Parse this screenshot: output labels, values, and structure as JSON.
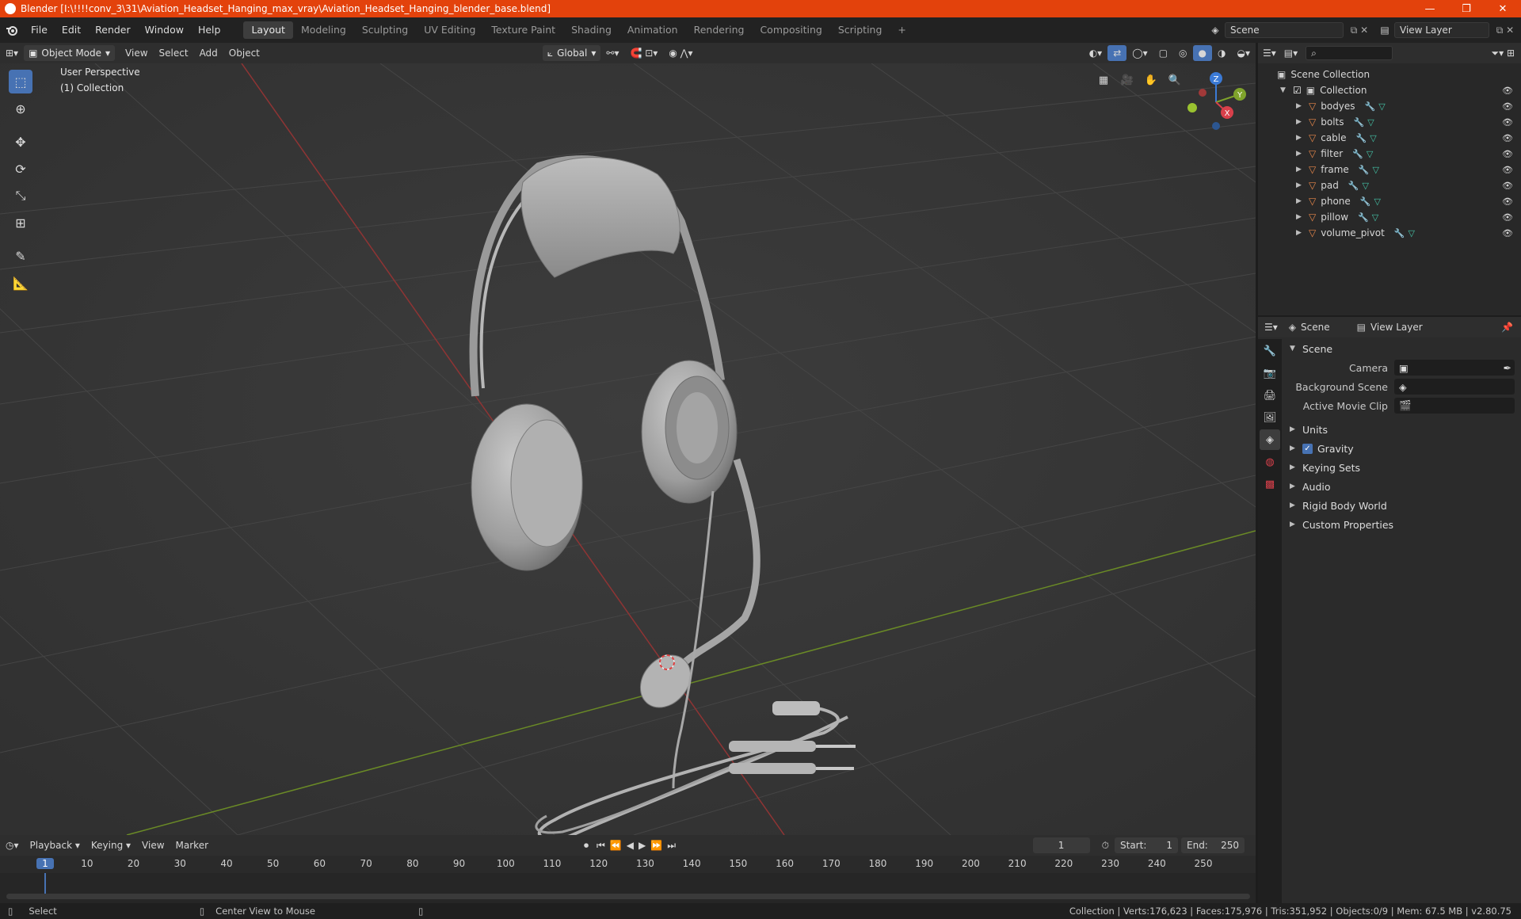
{
  "window": {
    "title": "Blender [I:\\!!!!conv_3\\31\\Aviation_Headset_Hanging_max_vray\\Aviation_Headset_Hanging_blender_base.blend]",
    "controls": [
      "—",
      "❐",
      "✕"
    ]
  },
  "menu": [
    "File",
    "Edit",
    "Render",
    "Window",
    "Help"
  ],
  "workspaces": [
    {
      "label": "Layout",
      "active": true
    },
    {
      "label": "Modeling"
    },
    {
      "label": "Sculpting"
    },
    {
      "label": "UV Editing"
    },
    {
      "label": "Texture Paint"
    },
    {
      "label": "Shading"
    },
    {
      "label": "Animation"
    },
    {
      "label": "Rendering"
    },
    {
      "label": "Compositing"
    },
    {
      "label": "Scripting"
    }
  ],
  "scene_field": "Scene",
  "view_layer_field": "View Layer",
  "viewport_header": {
    "mode": "Object Mode",
    "menus": [
      "View",
      "Select",
      "Add",
      "Object"
    ],
    "transform": "Global"
  },
  "viewport": {
    "perspective": "User Perspective",
    "collection": "(1) Collection"
  },
  "gizmo": {
    "z": "Z",
    "y": "Y",
    "x": "X"
  },
  "outliner": {
    "root": "Scene Collection",
    "collection": "Collection",
    "objects": [
      "bodyes",
      "bolts",
      "cable",
      "filter",
      "frame",
      "pad",
      "phone",
      "pillow",
      "volume_pivot"
    ]
  },
  "properties": {
    "tab_scene": "Scene",
    "tab_view_layer": "View Layer",
    "panel": "Scene",
    "fields": [
      {
        "label": "Camera"
      },
      {
        "label": "Background Scene"
      },
      {
        "label": "Active Movie Clip"
      }
    ],
    "sections": [
      {
        "label": "Units"
      },
      {
        "label": "Gravity",
        "checkbox": true
      },
      {
        "label": "Keying Sets"
      },
      {
        "label": "Audio"
      },
      {
        "label": "Rigid Body World"
      },
      {
        "label": "Custom Properties"
      }
    ]
  },
  "timeline": {
    "menus": [
      "Playback",
      "Keying",
      "View",
      "Marker"
    ],
    "current_frame": "1",
    "start_label": "Start:",
    "start": "1",
    "end_label": "End:",
    "end": "250",
    "ticks": [
      "1",
      "10",
      "20",
      "30",
      "40",
      "50",
      "60",
      "70",
      "80",
      "90",
      "100",
      "110",
      "120",
      "130",
      "140",
      "150",
      "160",
      "170",
      "180",
      "190",
      "200",
      "210",
      "220",
      "230",
      "240",
      "250"
    ]
  },
  "status": {
    "select": "Select",
    "center": "Center View to Mouse",
    "stats": "Collection | Verts:176,623 | Faces:175,976 | Tris:351,952 | Objects:0/9 | Mem: 67.5 MB | v2.80.75"
  }
}
